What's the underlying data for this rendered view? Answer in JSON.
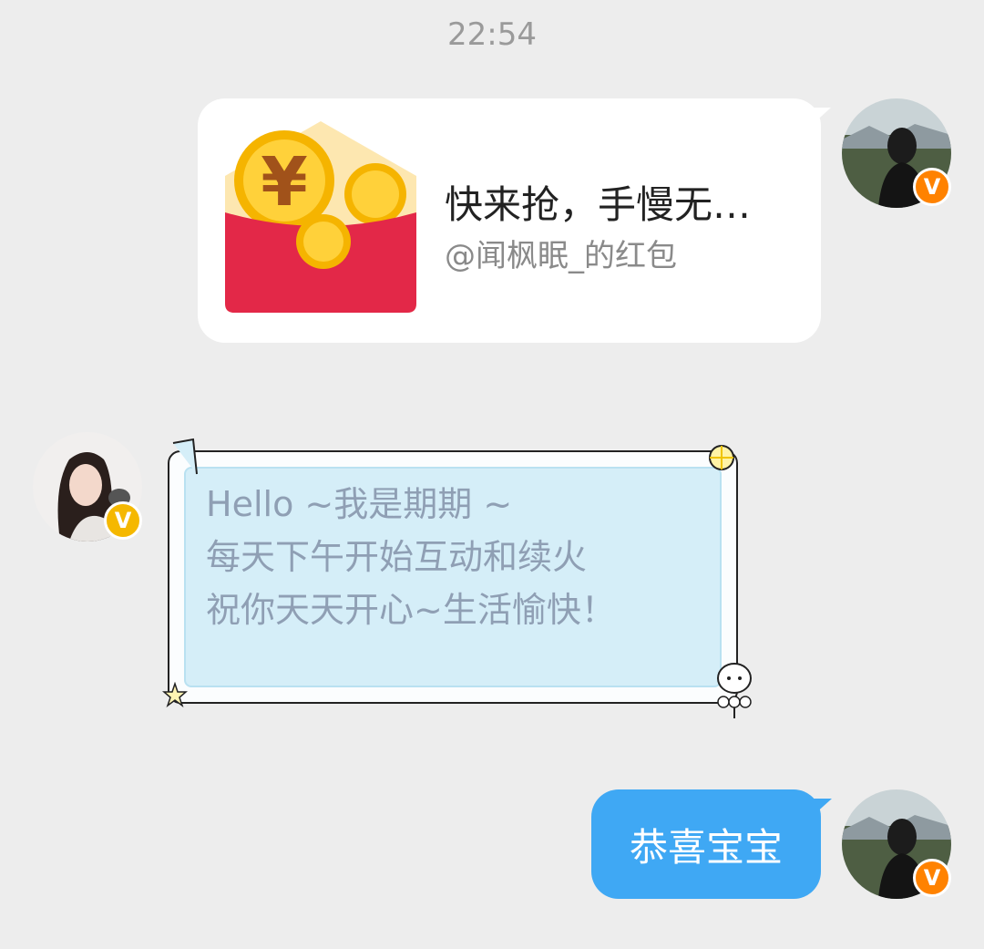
{
  "header": {
    "time": "22:54"
  },
  "messages": [
    {
      "type": "red_packet",
      "title": "快来抢，手慢无…",
      "subtitle": "@闻枫眠_的红包",
      "icon": "red-envelope-coins-icon",
      "sender_badge": "V"
    },
    {
      "type": "text_decorated",
      "lines": [
        "Hello ~我是期期 ~",
        "每天下午开始互动和续火",
        "祝你天天开心~生活愉快！"
      ],
      "sender_badge": "V"
    },
    {
      "type": "text",
      "text": "恭喜宝宝",
      "sender_badge": "V"
    }
  ],
  "colors": {
    "background": "#ededed",
    "outgoing_bubble": "#3fa8f4",
    "card": "#ffffff",
    "badge_orange": "#ff8200",
    "badge_gold": "#f5b800"
  }
}
